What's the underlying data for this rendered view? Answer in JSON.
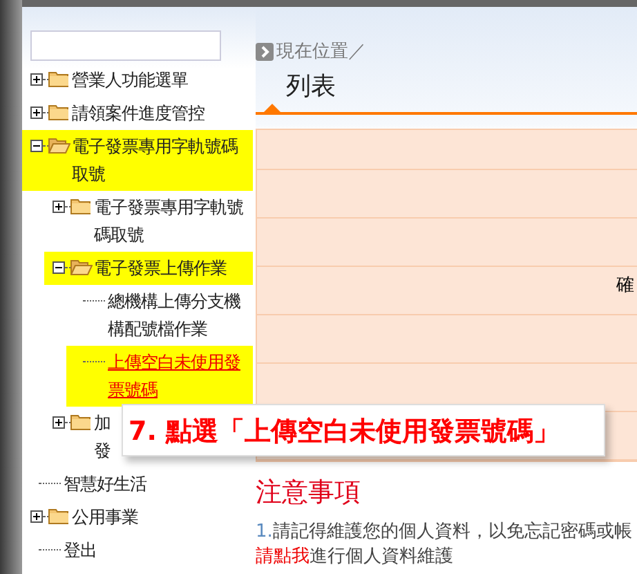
{
  "tree": [
    {
      "label": "營業人功能選單",
      "kind": "folder",
      "expanded": false,
      "highlighted": false
    },
    {
      "label": "請領案件進度管控",
      "kind": "folder",
      "expanded": false,
      "highlighted": false
    },
    {
      "label": "電子發票專用字軌號碼取號",
      "kind": "folder",
      "expanded": true,
      "highlighted": true,
      "children": [
        {
          "label": "電子發票專用字軌號碼取號",
          "kind": "folder",
          "expanded": false,
          "highlighted": false
        },
        {
          "label": "電子發票上傳作業",
          "kind": "folder",
          "expanded": true,
          "highlighted": true,
          "children": [
            {
              "label": "總機構上傳分支機構配號檔作業",
              "kind": "leaf",
              "link": false,
              "highlighted": false
            },
            {
              "label": "上傳空白未使用發票號碼",
              "kind": "leaf",
              "link": true,
              "highlighted": true
            }
          ]
        },
        {
          "label_lines": [
            "加",
            "發"
          ],
          "kind": "folder",
          "expanded": false,
          "highlighted": false
        }
      ]
    },
    {
      "label": "智慧好生活",
      "kind": "leaf",
      "link": false,
      "highlighted": false
    },
    {
      "label": "公用事業",
      "kind": "folder",
      "expanded": false,
      "highlighted": false
    },
    {
      "label": "登出",
      "kind": "leaf",
      "link": false,
      "highlighted": false
    }
  ],
  "breadcrumb": "現在位置／",
  "page_title": "列表",
  "table": {
    "cell_text": "確"
  },
  "callout": "7. 點選「上傳空白未使用發票號碼」",
  "notes": {
    "title": "注意事項",
    "items": [
      {
        "number": "1.",
        "text": "請記得維護您的個人資料，以免忘記密碼或帳",
        "link": "請點我",
        "after": "進行個人資料維護"
      }
    ]
  }
}
